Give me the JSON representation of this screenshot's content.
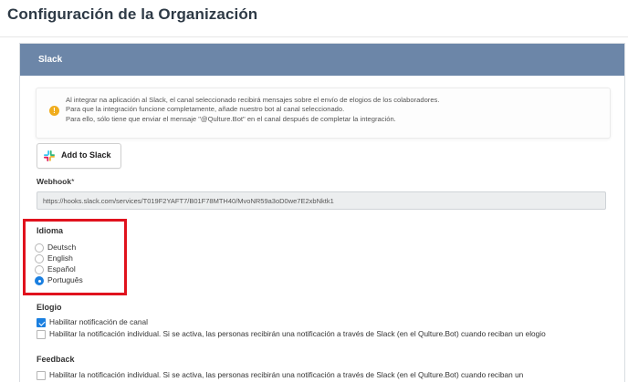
{
  "page": {
    "title": "Configuración de la Organización"
  },
  "card": {
    "header": "Slack"
  },
  "info": {
    "lines": [
      "Al integrar na aplicación al Slack, el canal seleccionado recibirá mensajes sobre el envío de elogios de los colaboradores.",
      "Para que la integración funcione completamente, añade nuestro bot al canal seleccionado.",
      "Para ello, sólo tiene que enviar el mensaje \"@Qulture.Bot\" en el canal después de completar la integración."
    ],
    "icon": "warning-info-icon",
    "icon_glyph": "!",
    "icon_color": "#f0ad1e"
  },
  "slack_button": {
    "label_plain": "Add to ",
    "label_strong": "Slack",
    "icon": "slack-logo-icon"
  },
  "webhook": {
    "label": "Webhook",
    "required_mark": "*",
    "value": "https://hooks.slack.com/services/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"
  },
  "language": {
    "title": "Idioma",
    "options": [
      {
        "label": "Deutsch",
        "checked": false
      },
      {
        "label": "English",
        "checked": false
      },
      {
        "label": "Español",
        "checked": false
      },
      {
        "label": "Português",
        "checked": true
      }
    ],
    "highlight_color": "#e0121d"
  },
  "praise": {
    "title": "Elogio",
    "options": [
      {
        "label": "Habilitar notificación de canal",
        "checked": true
      },
      {
        "label": "Habilitar la notificación individual. Si se activa, las personas recibirán una notificación a través de Slack (en el Qulture.Bot) cuando reciban un elogio",
        "checked": false
      }
    ]
  },
  "feedback": {
    "title": "Feedback",
    "options": [
      {
        "label": "Habilitar la notificación individual. Si se activa, las personas recibirán una notificación a través de Slack (en el Qulture.Bot) cuando reciban un",
        "checked": false
      }
    ]
  },
  "colors": {
    "header_bg": "#6c86a8",
    "accent": "#1a7fe0"
  }
}
